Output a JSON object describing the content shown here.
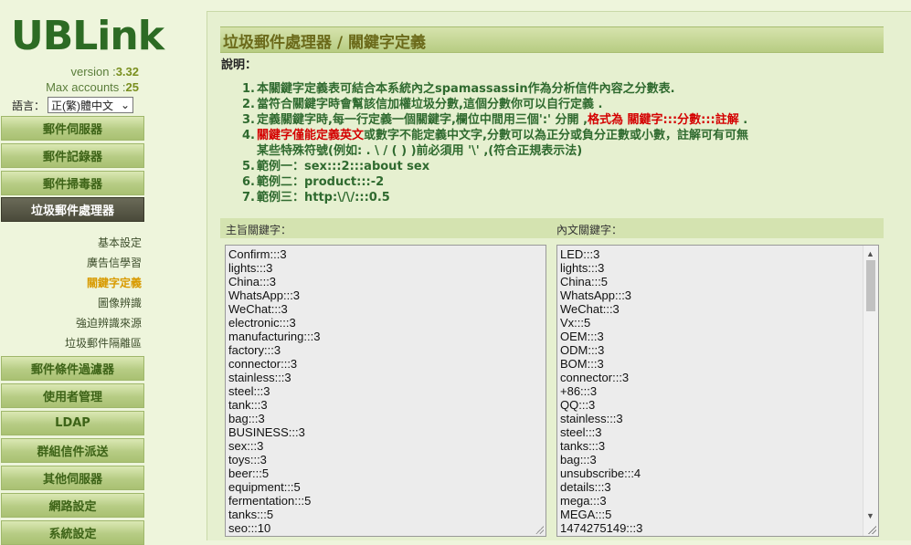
{
  "sidebar": {
    "logo": "UBLink",
    "version_label": "version :",
    "version_value": "3.32",
    "max_accounts_label": "Max accounts :",
    "max_accounts_value": "25",
    "language_label": "語言：",
    "language_value": "正(繁)體中文",
    "nav": [
      {
        "label": "郵件伺服器"
      },
      {
        "label": "郵件記錄器"
      },
      {
        "label": "郵件掃毒器"
      },
      {
        "label": "垃圾郵件處理器",
        "active": true
      },
      {
        "label": "郵件條件過濾器"
      },
      {
        "label": "使用者管理"
      },
      {
        "label": "LDAP"
      },
      {
        "label": "群組信件派送"
      },
      {
        "label": "其他伺服器"
      },
      {
        "label": "網路設定"
      },
      {
        "label": "系統設定"
      }
    ],
    "subitems": [
      {
        "label": "基本設定"
      },
      {
        "label": "廣告信學習"
      },
      {
        "label": "關鍵字定義",
        "active": true
      },
      {
        "label": "圖像辨識"
      },
      {
        "label": "強迫辨識來源"
      },
      {
        "label": "垃圾郵件隔離區"
      }
    ]
  },
  "main": {
    "title": "垃圾郵件處理器 / 關鍵字定義",
    "desc_label": "說明：",
    "desc": [
      {
        "num": "1.",
        "text": "本關鍵字定義表可結合本系統內之spamassassin作為分析信件內容之分數表."
      },
      {
        "num": "2.",
        "text": "當符合關鍵字時會幫該信加權垃圾分數,這個分數你可以自行定義 ."
      },
      {
        "num": "3.",
        "text": "定義關鍵字時,每一行定義一個關鍵字,欄位中間用三個':' 分開 ,",
        "red": "格式為 關鍵字:::分數:::註解",
        "tail": " ."
      },
      {
        "num": "4.",
        "red": "關鍵字僅能定義英文",
        "text": "或數字不能定義中文字,分數可以為正分或負分正數或小數，註解可有可無"
      },
      {
        "num": "",
        "text": "某些特殊符號(例如: . \\ / ( ) )前必須用 '\\' ,(符合正規表示法)"
      },
      {
        "num": "5.",
        "text": "範例一：sex:::2:::about sex"
      },
      {
        "num": "6.",
        "text": "範例二：product:::-2"
      },
      {
        "num": "7.",
        "text": "範例三：http:\\/\\/:::0.5"
      }
    ],
    "subject_label": "主旨關鍵字：",
    "body_label": "內文關鍵字：",
    "subject_keywords": [
      "Confirm:::3",
      "lights:::3",
      "China:::3",
      "WhatsApp:::3",
      "WeChat:::3",
      "electronic:::3",
      "manufacturing:::3",
      "factory:::3",
      "connector:::3",
      "stainless:::3",
      "steel:::3",
      "tank:::3",
      "bag:::3",
      "BUSINESS:::3",
      "sex:::3",
      "toys:::3",
      "beer:::5",
      "equipment:::5",
      "fermentation:::5",
      "tanks:::5",
      "seo:::10"
    ],
    "body_keywords": [
      "LED:::3",
      "lights:::3",
      "China:::5",
      "WhatsApp:::3",
      "WeChat:::3",
      "Vx:::5",
      "OEM:::3",
      "ODM:::3",
      "BOM:::3",
      "connector:::3",
      "+86:::3",
      "QQ:::3",
      "stainless:::3",
      "steel:::3",
      "tanks:::3",
      "bag:::3",
      "unsubscribe:::4",
      "details:::3",
      "mega:::3",
      "MEGA:::5",
      "1474275149:::3"
    ]
  }
}
